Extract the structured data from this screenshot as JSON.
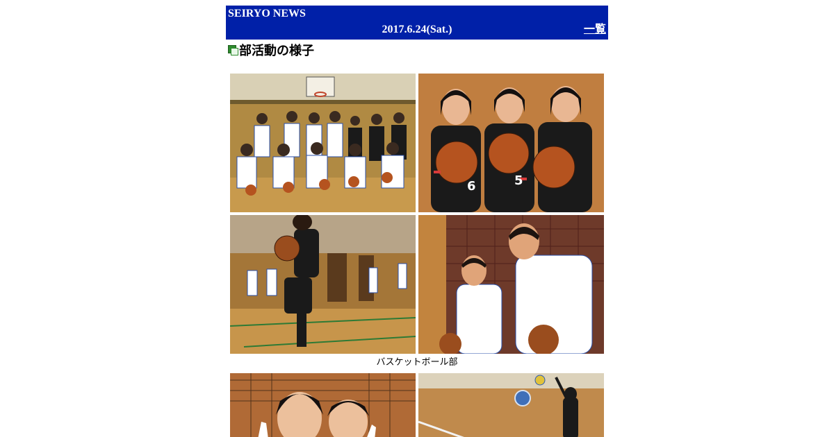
{
  "header": {
    "site_title": "SEIRYO NEWS",
    "date": "2017.6.24(Sat.)",
    "list_link": "一覧"
  },
  "article": {
    "title": "部活動の様子"
  },
  "gallery": {
    "basketball_caption": "バスケットボール部",
    "photos": [
      {
        "name": "basketball-team-group-photo"
      },
      {
        "name": "basketball-three-girls-photo"
      },
      {
        "name": "basketball-dribbling-photo"
      },
      {
        "name": "basketball-boys-practice-photo"
      },
      {
        "name": "volleyball-two-girls-photo"
      },
      {
        "name": "volleyball-serve-photo"
      }
    ]
  },
  "colors": {
    "header_bg": "#0020a8",
    "header_text": "#ffffff",
    "bullet_green": "#2e8b2e"
  }
}
